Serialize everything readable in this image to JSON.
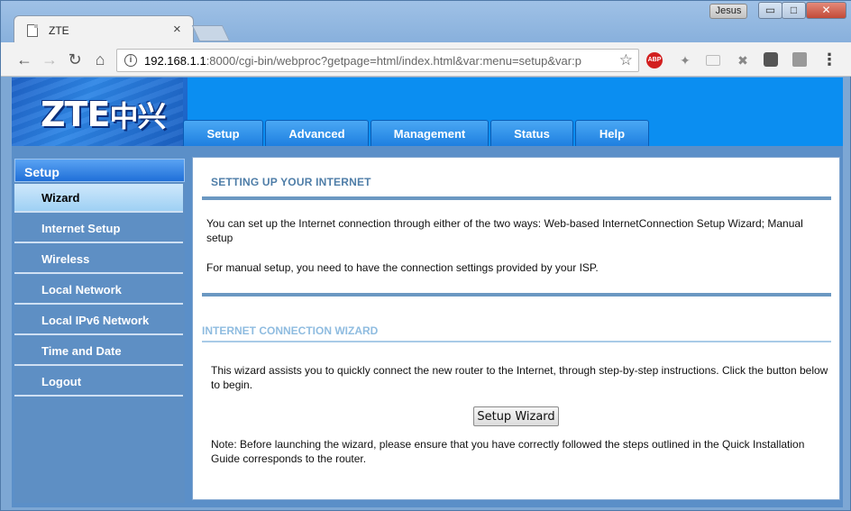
{
  "browser": {
    "tab_title": "ZTE",
    "tab_close": "×",
    "user_name": "Jesus",
    "url_host": "192.168.1.1",
    "url_rest": ":8000/cgi-bin/webproc?getpage=html/index.html&var:menu=setup&var:p",
    "minimize": "▭",
    "maximize": "□",
    "close": "✕",
    "abp_label": "ABP"
  },
  "banner": {
    "logo_text": "ZTE",
    "logo_cn": "中兴",
    "tabs": [
      {
        "label": "Setup"
      },
      {
        "label": "Advanced"
      },
      {
        "label": "Management"
      },
      {
        "label": "Status"
      },
      {
        "label": "Help"
      }
    ]
  },
  "sidebar": {
    "header": "Setup",
    "items": [
      {
        "label": "Wizard",
        "active": true
      },
      {
        "label": "Internet Setup"
      },
      {
        "label": "Wireless"
      },
      {
        "label": "Local Network"
      },
      {
        "label": "Local IPv6 Network"
      },
      {
        "label": "Time and Date"
      },
      {
        "label": "Logout"
      }
    ]
  },
  "content": {
    "section1_title": "SETTING UP YOUR INTERNET",
    "section1_p1": "You can set up the Internet connection through either of the two ways: Web-based InternetConnection Setup Wizard; Manual setup",
    "section1_p2": "For manual setup, you need to have the connection settings provided by your ISP.",
    "section2_title": "INTERNET CONNECTION WIZARD",
    "section2_p1": "This wizard assists you to quickly connect the new router to the Internet, through step-by-step instructions. Click the button below to begin.",
    "wizard_button": "Setup Wizard",
    "section2_note": "Note: Before launching the wizard, please ensure that you have correctly followed the steps outlined in the Quick Installation Guide corresponds to the router."
  }
}
